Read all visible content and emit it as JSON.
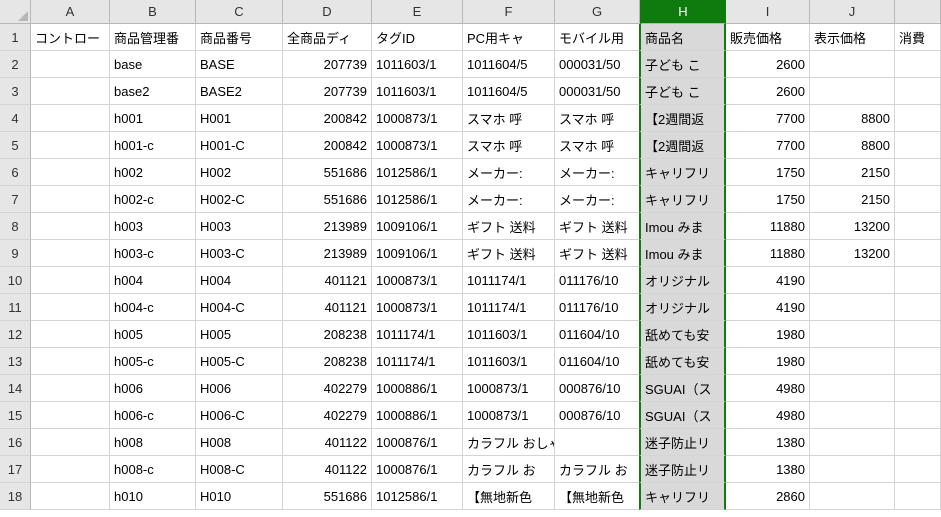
{
  "columns": [
    "A",
    "B",
    "C",
    "D",
    "E",
    "F",
    "G",
    "H",
    "I",
    "J"
  ],
  "selectedColumn": "H",
  "headers": {
    "A": "コントロー",
    "B": "商品管理番",
    "C": "商品番号",
    "D": "全商品ディ",
    "E": "タグID",
    "F": "PC用キャ",
    "G": "モバイル用",
    "H": "商品名",
    "I": "販売価格",
    "J": "表示価格",
    "K": "消費"
  },
  "rows": [
    {
      "n": 1
    },
    {
      "n": 2,
      "B": "base",
      "C": "BASE",
      "D": "207739",
      "E": "1011603/1",
      "F": "1011604/5",
      "G": "000031/50",
      "H": "子ども こ",
      "I": "2600",
      "J": ""
    },
    {
      "n": 3,
      "B": "base2",
      "C": "BASE2",
      "D": "207739",
      "E": "1011603/1",
      "F": "1011604/5",
      "G": "000031/50",
      "H": "子ども こ",
      "I": "2600",
      "J": ""
    },
    {
      "n": 4,
      "B": "h001",
      "C": "H001",
      "D": "200842",
      "E": "1000873/1",
      "F": "スマホ 呼",
      "G": "スマホ 呼",
      "H": "【2週間返",
      "I": "7700",
      "J": "8800"
    },
    {
      "n": 5,
      "B": "h001-c",
      "C": "H001-C",
      "D": "200842",
      "E": "1000873/1",
      "F": "スマホ 呼",
      "G": "スマホ 呼",
      "H": "【2週間返",
      "I": "7700",
      "J": "8800"
    },
    {
      "n": 6,
      "B": "h002",
      "C": "H002",
      "D": "551686",
      "E": "1012586/1",
      "F": "メーカー:",
      "G": "メーカー:",
      "H": "キャリフリ",
      "I": "1750",
      "J": "2150"
    },
    {
      "n": 7,
      "B": "h002-c",
      "C": "H002-C",
      "D": "551686",
      "E": "1012586/1",
      "F": "メーカー:",
      "G": "メーカー:",
      "H": "キャリフリ",
      "I": "1750",
      "J": "2150"
    },
    {
      "n": 8,
      "B": "h003",
      "C": "H003",
      "D": "213989",
      "E": "1009106/1",
      "F": "ギフト 送料",
      "G": "ギフト 送料",
      "H": "Imou みま",
      "I": "11880",
      "J": "13200"
    },
    {
      "n": 9,
      "B": "h003-c",
      "C": "H003-C",
      "D": "213989",
      "E": "1009106/1",
      "F": "ギフト 送料",
      "G": "ギフト 送料",
      "H": "Imou みま",
      "I": "11880",
      "J": "13200"
    },
    {
      "n": 10,
      "B": "h004",
      "C": "H004",
      "D": "401121",
      "E": "1000873/1",
      "F": "1011174/1",
      "G": "011176/10",
      "H": "オリジナル",
      "I": "4190",
      "J": ""
    },
    {
      "n": 11,
      "B": "h004-c",
      "C": "H004-C",
      "D": "401121",
      "E": "1000873/1",
      "F": "1011174/1",
      "G": "011176/10",
      "H": "オリジナル",
      "I": "4190",
      "J": ""
    },
    {
      "n": 12,
      "B": "h005",
      "C": "H005",
      "D": "208238",
      "E": "1011174/1",
      "F": "1011603/1",
      "G": "011604/10",
      "H": "舐めても安",
      "I": "1980",
      "J": ""
    },
    {
      "n": 13,
      "B": "h005-c",
      "C": "H005-C",
      "D": "208238",
      "E": "1011174/1",
      "F": "1011603/1",
      "G": "011604/10",
      "H": "舐めても安",
      "I": "1980",
      "J": ""
    },
    {
      "n": 14,
      "B": "h006",
      "C": "H006",
      "D": "402279",
      "E": "1000886/1",
      "F": "1000873/1",
      "G": "000876/10",
      "H": "SGUAI（ス",
      "I": "4980",
      "J": ""
    },
    {
      "n": 15,
      "B": "h006-c",
      "C": "H006-C",
      "D": "402279",
      "E": "1000886/1",
      "F": "1000873/1",
      "G": "000876/10",
      "H": "SGUAI（ス",
      "I": "4980",
      "J": ""
    },
    {
      "n": 16,
      "B": "h008",
      "C": "H008",
      "D": "401122",
      "E": "1000876/1",
      "F": "カラフル おしゃれ か",
      "G": "",
      "H": "迷子防止リ",
      "I": "1380",
      "J": ""
    },
    {
      "n": 17,
      "B": "h008-c",
      "C": "H008-C",
      "D": "401122",
      "E": "1000876/1",
      "F": "カラフル お",
      "G": "カラフル お",
      "H": "迷子防止リ",
      "I": "1380",
      "J": ""
    },
    {
      "n": 18,
      "B": "h010",
      "C": "H010",
      "D": "551686",
      "E": "1012586/1",
      "F": "【無地新色",
      "G": "【無地新色",
      "H": "キャリフリ",
      "I": "2860",
      "J": ""
    }
  ]
}
